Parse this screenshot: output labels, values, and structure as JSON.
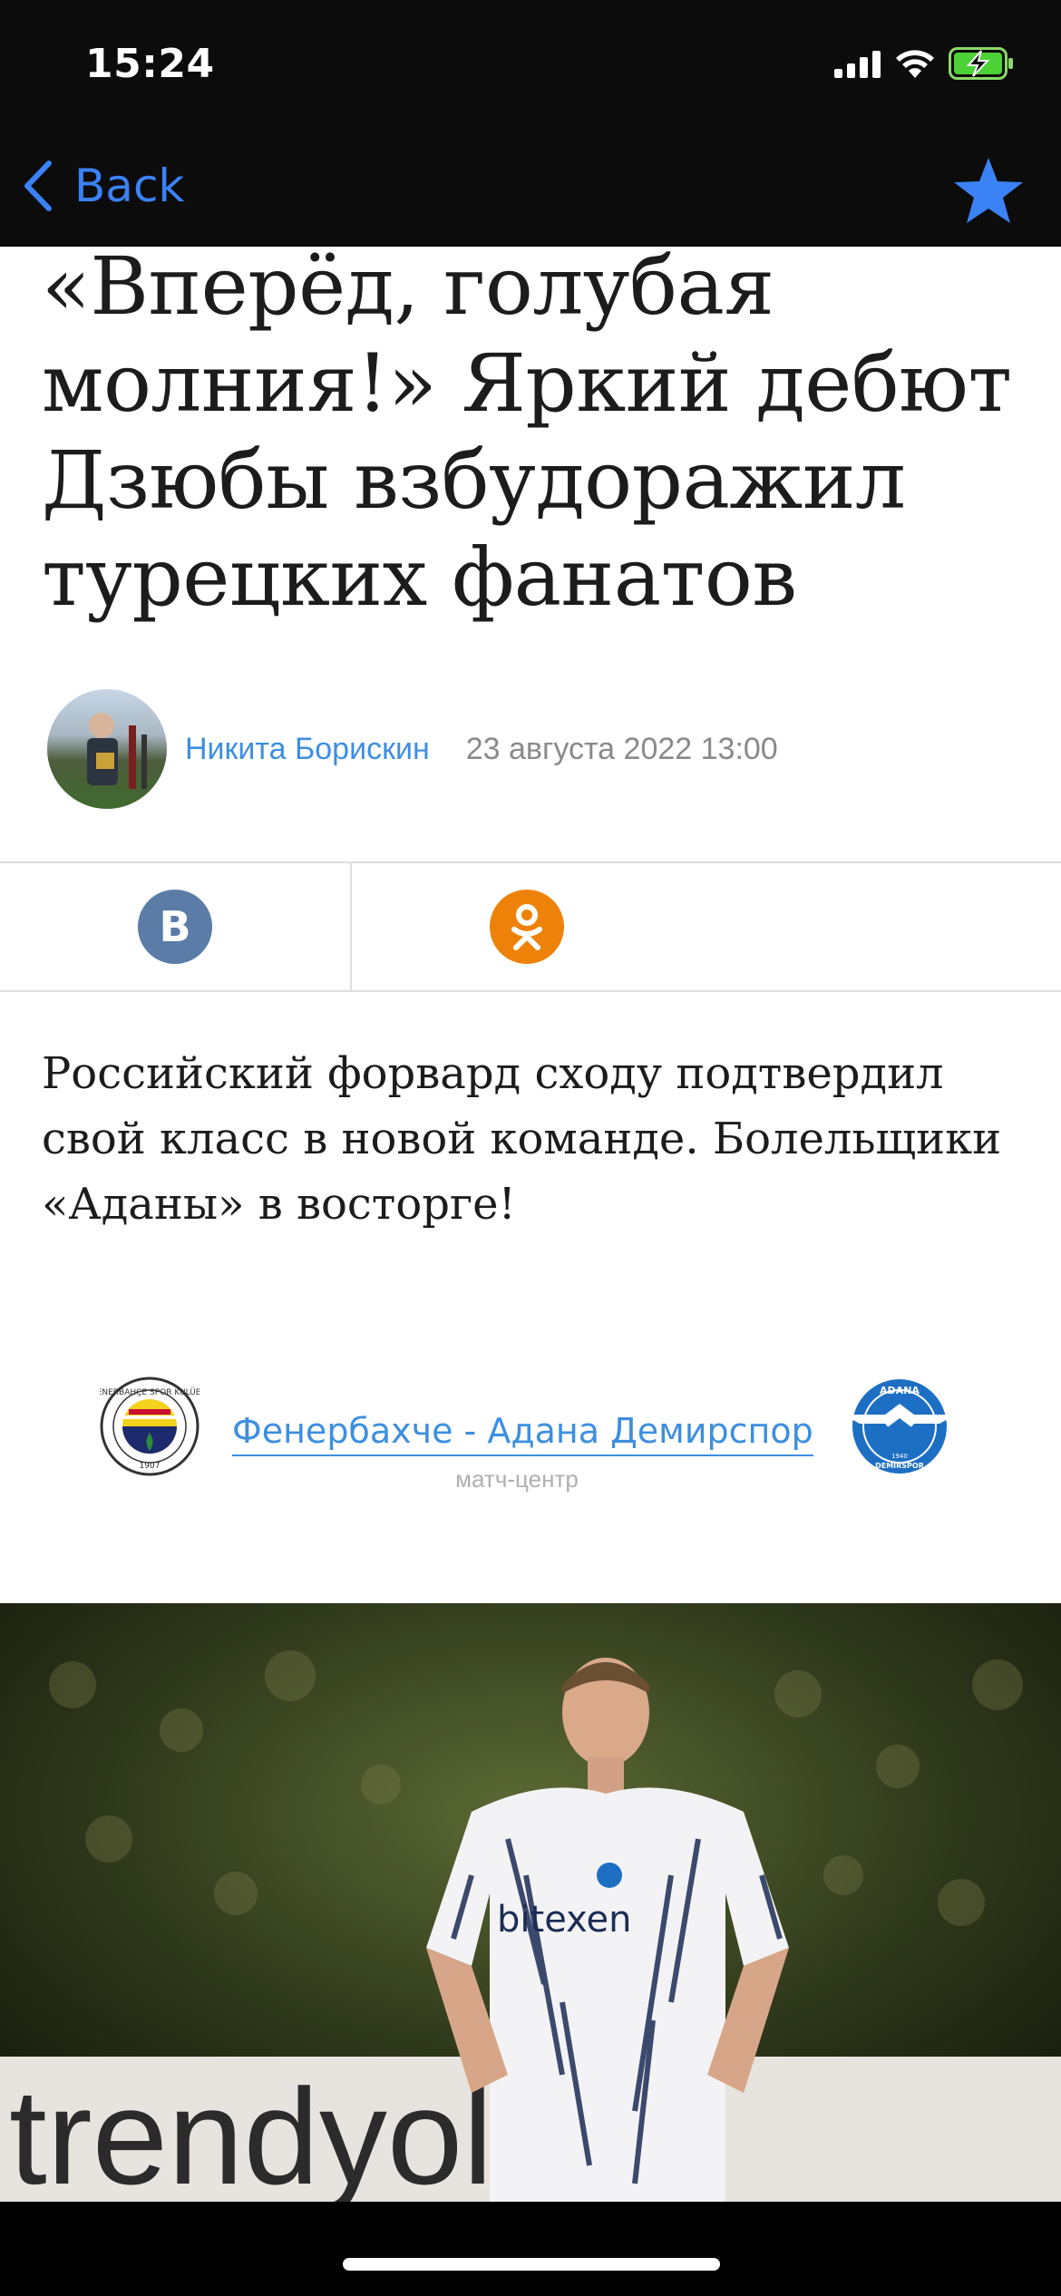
{
  "status_bar": {
    "time": "15:24"
  },
  "nav": {
    "back_label": "Back"
  },
  "article": {
    "title": "«Вперёд, голубая молния!» Яркий дебют Дзюбы взбудоражил турецких фанатов",
    "author": "Никита Борискин",
    "date": "23 августа 2022 13:00",
    "lead": "Российский форвард сходу подтвердил свой класс в новой команде. Болельщики «Аданы» в восторге!"
  },
  "share": {
    "vk_glyph": "В"
  },
  "match": {
    "title": "Фенербахче - Адана Демирспор",
    "subtitle": "матч-центр",
    "home_logo": {
      "ring_text": "FENERBAHÇE SPOR KULÜBÜ",
      "year": "1907"
    },
    "away_logo": {
      "top_text": "ADANA",
      "year": "1940",
      "bottom_text": "DEMİRSPOR"
    }
  },
  "photo": {
    "jersey_text": "bitexen",
    "banner_text": "trendyol"
  },
  "colors": {
    "accent": "#3b82f6",
    "link": "#3d8fe0",
    "vk": "#5a7ca6",
    "ok": "#ee8208",
    "adana_blue": "#1d6fc4"
  }
}
